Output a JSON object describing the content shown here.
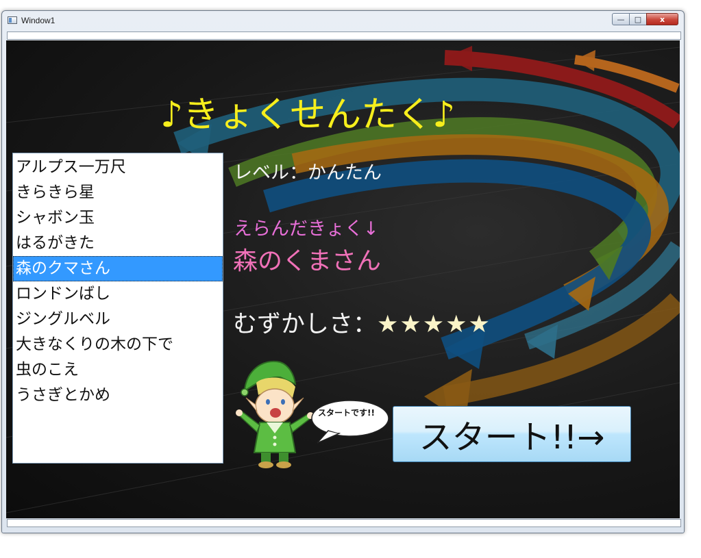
{
  "window": {
    "title": "Window1",
    "controls": {
      "minimize": "—",
      "maximize": "□",
      "close": "x"
    }
  },
  "heading": "♪きょくせんたく♪",
  "song_list": {
    "items": [
      {
        "label": "アルプス一万尺"
      },
      {
        "label": "きらきら星"
      },
      {
        "label": "シャボン玉"
      },
      {
        "label": "はるがきた"
      },
      {
        "label": "森のクマさん",
        "selected": true
      },
      {
        "label": "ロンドンばし"
      },
      {
        "label": "ジングルベル"
      },
      {
        "label": "大きなくりの木の下で"
      },
      {
        "label": "虫のこえ"
      },
      {
        "label": "うさぎとかめ"
      }
    ]
  },
  "info": {
    "level": "レベル：かんたん",
    "chosen_label": "えらんだきょく↓",
    "chosen_song": "森のくまさん",
    "difficulty_label": "むずかしさ：",
    "difficulty_stars": "★★★★★"
  },
  "mascot": {
    "speech": "スタートです!!"
  },
  "start_button": {
    "label": "スタート!!→"
  },
  "colors": {
    "heading": "#f6ee1c",
    "chosen_label": "#e86fd8",
    "chosen_song": "#f071b8",
    "selection": "#3399ff",
    "stars": "#faf4c8"
  }
}
